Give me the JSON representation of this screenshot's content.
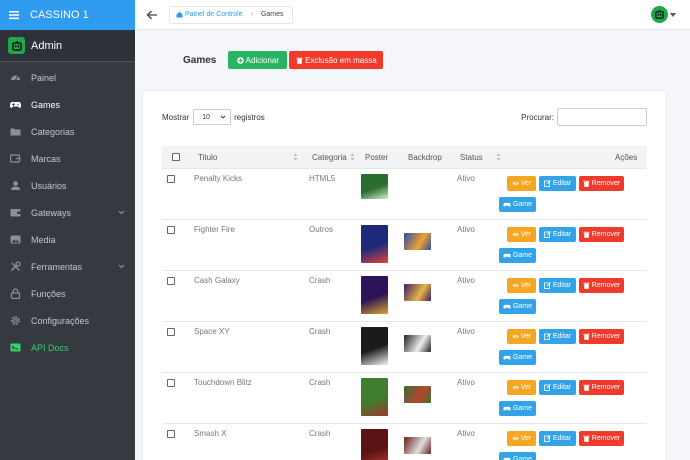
{
  "brand": {
    "title": "CASSINO 1"
  },
  "user": {
    "name": "Admin"
  },
  "nav": [
    {
      "label": "Painel",
      "icon": "gauge-icon"
    },
    {
      "label": "Games",
      "icon": "gamepad-icon",
      "active": true
    },
    {
      "label": "Categorias",
      "icon": "folder-icon"
    },
    {
      "label": "Marcas",
      "icon": "tag-icon"
    },
    {
      "label": "Usuários",
      "icon": "user-icon"
    },
    {
      "label": "Gateways",
      "icon": "wallet-icon",
      "expandable": true
    },
    {
      "label": "Media",
      "icon": "image-icon"
    },
    {
      "label": "Ferramentas",
      "icon": "tools-icon",
      "expandable": true
    },
    {
      "label": "Funções",
      "icon": "lock-icon"
    },
    {
      "label": "Configurações",
      "icon": "gear-icon"
    },
    {
      "label": "API Docs",
      "icon": "terminal-icon"
    }
  ],
  "breadcrumb": {
    "home": "Painel de Controle",
    "current": "Games"
  },
  "page": {
    "title": "Games",
    "add_label": "Adicionar",
    "mass_delete_label": "Exclusão em massa"
  },
  "table_controls": {
    "show_label": "Mostrar",
    "page_size": "10",
    "records_label": "registros",
    "search_label": "Procurar:"
  },
  "columns": {
    "title": "Titulo",
    "category": "Categoria",
    "poster": "Poster",
    "backdrop": "Backdrop",
    "status": "Status",
    "actions": "Ações"
  },
  "action_labels": {
    "view": "Ver",
    "edit": "Editar",
    "remove": "Remover",
    "game": "Game"
  },
  "rows": [
    {
      "title": "Penalty Kicks",
      "category": "HTML5",
      "status": "Ativo"
    },
    {
      "title": "Fighter Fire",
      "category": "Outros",
      "status": "Ativo"
    },
    {
      "title": "Cash Galaxy",
      "category": "Crash",
      "status": "Ativo"
    },
    {
      "title": "Space XY",
      "category": "Crash",
      "status": "Ativo"
    },
    {
      "title": "Touchdown Blitz",
      "category": "Crash",
      "status": "Ativo"
    },
    {
      "title": "Smash X",
      "category": "Crash",
      "status": "Ativo"
    }
  ],
  "colors": {
    "brand": "#2f9cf0",
    "sidebar": "#343a40",
    "success": "#28b463",
    "danger": "#f03b2c",
    "warning": "#f5a623",
    "info": "#33a3e8",
    "api": "#35d36b"
  }
}
